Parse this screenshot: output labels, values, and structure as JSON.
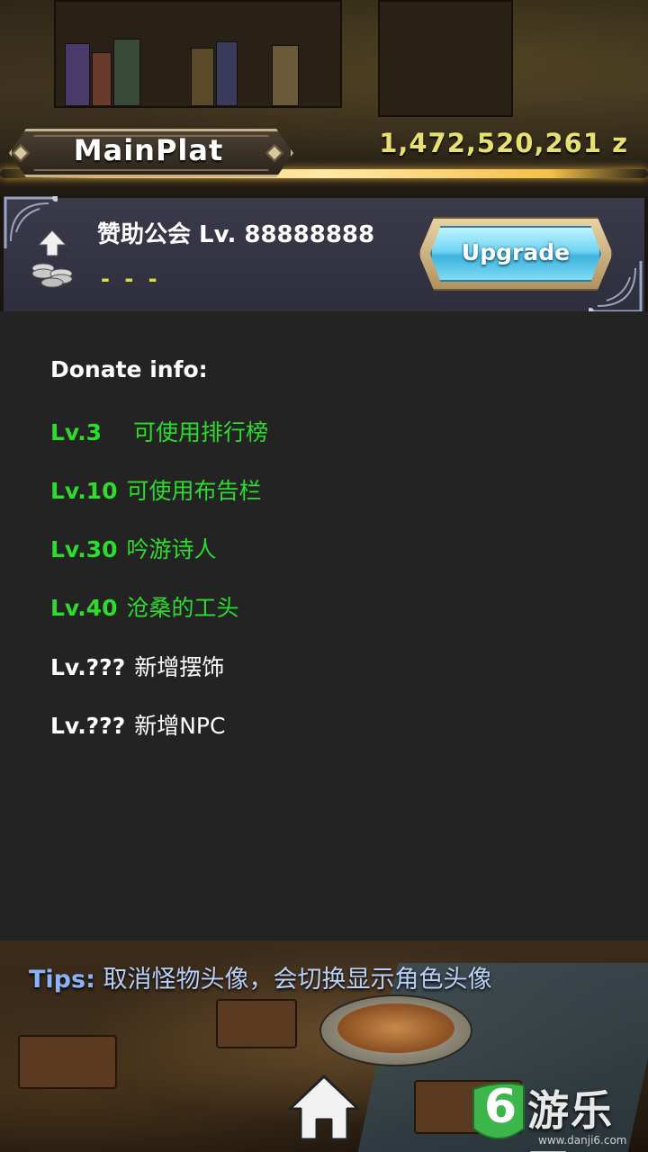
{
  "header": {
    "title": "MainPlat",
    "currency": "1,472,520,261 z"
  },
  "guild": {
    "title": "赞助公会 Lv. 88888888",
    "subtitle": "- - -",
    "upgrade_label": "Upgrade"
  },
  "donate": {
    "heading": "Donate info:",
    "perks": [
      {
        "level": "Lv.3",
        "desc": "可使用排行榜",
        "color": "#2ddc2d"
      },
      {
        "level": "Lv.10",
        "desc": "可使用布告栏",
        "color": "#2ddc2d"
      },
      {
        "level": "Lv.30",
        "desc": "吟游诗人",
        "color": "#2ddc2d"
      },
      {
        "level": "Lv.40",
        "desc": "沧桑的工头",
        "color": "#2ddc2d"
      },
      {
        "level": "Lv.???",
        "desc": "新增摆饰",
        "color": "#ffffff"
      },
      {
        "level": "Lv.???",
        "desc": "新增NPC",
        "color": "#ffffff"
      }
    ]
  },
  "tips": {
    "label": "Tips:",
    "text": "取消怪物头像，会切换显示角色头像"
  },
  "watermark": {
    "logo_digit": "6",
    "name": "游乐网",
    "url": "www.danji6.com"
  },
  "icons": {
    "guild_icon": "coins-upgrade-icon",
    "home_icon": "home-icon"
  },
  "colors": {
    "accent_gold": "#f5c04a",
    "currency": "#e8e070",
    "unlocked": "#2ddc2d",
    "tips_label": "#8ab4f5"
  }
}
